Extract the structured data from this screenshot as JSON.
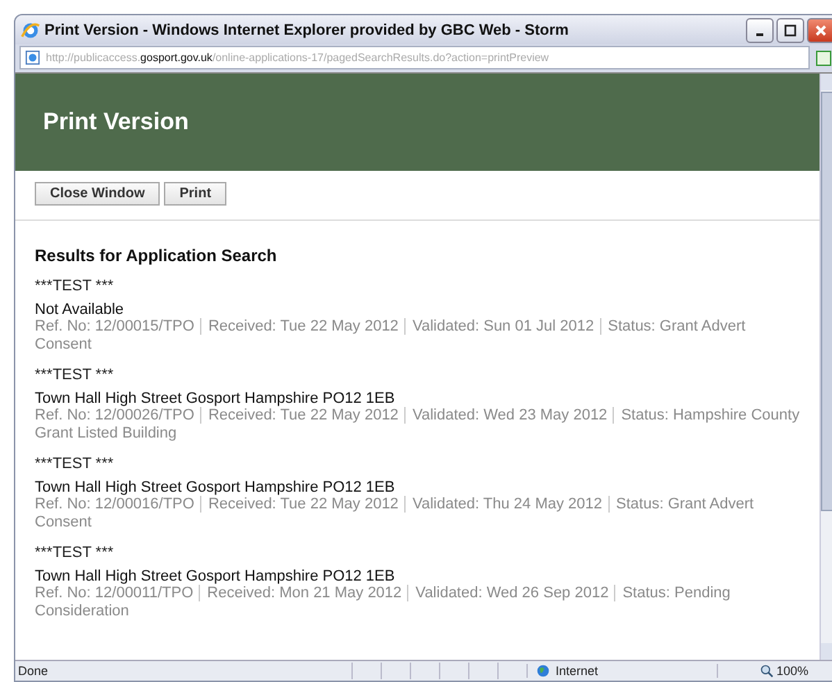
{
  "window": {
    "title": "Print Version - Windows Internet Explorer provided by GBC Web - Storm"
  },
  "address": {
    "prefix": "http://publicaccess.",
    "domain": "gosport.gov.uk",
    "path": "/online-applications-17/pagedSearchResults.do?action=printPreview"
  },
  "page_header": {
    "title": "Print Version"
  },
  "buttons": [
    "Close Window",
    "Print"
  ],
  "results": {
    "heading": "Results for Application Search",
    "items": [
      {
        "title": "***TEST ***",
        "address": "Not Available",
        "meta": [
          "Ref. No: 12/00015/TPO",
          "Received: Tue 22 May 2012",
          "Validated: Sun 01 Jul 2012",
          "Status: Grant Advert Consent"
        ]
      },
      {
        "title": "***TEST ***",
        "address": "Town Hall High Street Gosport Hampshire PO12 1EB",
        "meta": [
          "Ref. No: 12/00026/TPO",
          "Received: Tue 22 May 2012",
          "Validated: Wed 23 May 2012",
          "Status: Hampshire County Grant Listed Building"
        ]
      },
      {
        "title": "***TEST ***",
        "address": "Town Hall High Street Gosport Hampshire PO12 1EB",
        "meta": [
          "Ref. No: 12/00016/TPO",
          "Received: Tue 22 May 2012",
          "Validated: Thu 24 May 2012",
          "Status: Grant Advert Consent"
        ]
      },
      {
        "title": "***TEST ***",
        "address": "Town Hall High Street Gosport Hampshire PO12 1EB",
        "meta": [
          "Ref. No: 12/00011/TPO",
          "Received: Mon 21 May 2012",
          "Validated: Wed 26 Sep 2012",
          "Status: Pending Consideration"
        ]
      }
    ]
  },
  "status_bar": {
    "status": "Done",
    "zone": "Internet",
    "zoom": "100%"
  }
}
